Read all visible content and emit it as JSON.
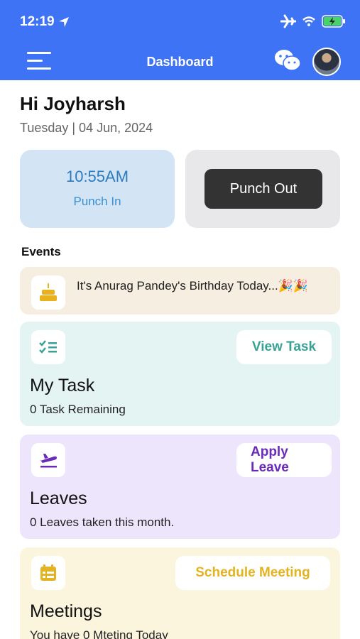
{
  "status_bar": {
    "time": "12:19"
  },
  "header": {
    "title": "Dashboard"
  },
  "greeting": {
    "name": "Hi Joyharsh",
    "date": "Tuesday  |  04 Jun, 2024"
  },
  "punch": {
    "time": "10:55AM",
    "in_label": "Punch In",
    "out_label": "Punch Out"
  },
  "events": {
    "heading": "Events",
    "items": [
      {
        "text": "It's Anurag Pandey's Birthday Today...🎉🎉"
      }
    ]
  },
  "task": {
    "title": "My Task",
    "subtitle": "0 Task Remaining",
    "button": "View Task"
  },
  "leaves": {
    "title": "Leaves",
    "subtitle": "0 Leaves taken this month.",
    "button": "Apply Leave"
  },
  "meetings": {
    "title": "Meetings",
    "subtitle": "You have 0 Mteting Today",
    "button": "Schedule Meeting"
  },
  "colors": {
    "header": "#3f73f5",
    "task_accent": "#3aa295",
    "leave_accent": "#6a2bb8",
    "meeting_accent": "#e3b321"
  },
  "icons": [
    "location-arrow-icon",
    "airplane-icon",
    "wifi-icon",
    "battery-icon",
    "menu-icon",
    "wechat-icon",
    "cake-icon",
    "checklist-icon",
    "flight-takeoff-icon",
    "calendar-icon"
  ]
}
